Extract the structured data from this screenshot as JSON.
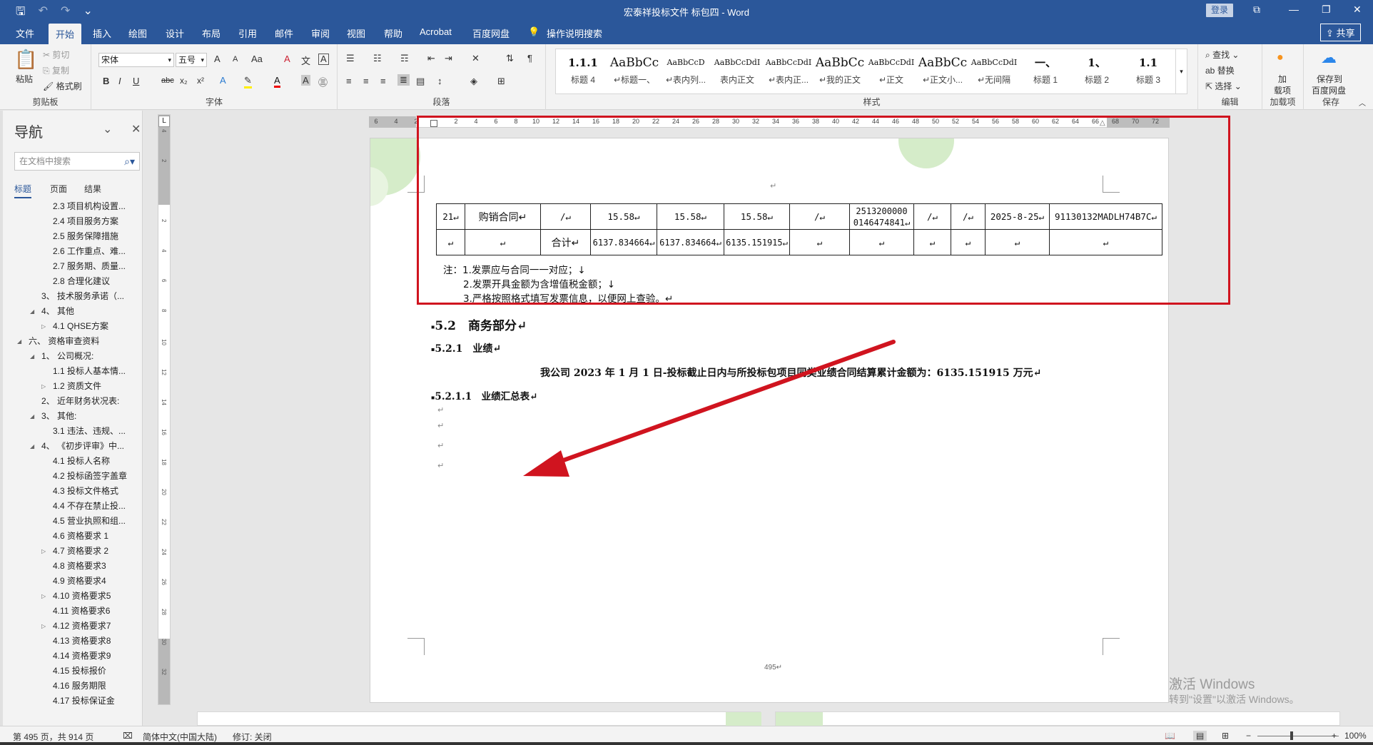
{
  "window": {
    "title": "宏泰祥投标文件 标包四 - Word",
    "login_label": "登录",
    "minimize_glyph": "—",
    "maximize_glyph": "❐",
    "close_glyph": "✕",
    "ribbon_display_glyph": "⧉",
    "save_glyph": "🖫",
    "undo_glyph": "↶",
    "redo_glyph": "↷",
    "customize_glyph": "⌄"
  },
  "ribbon_tabs": [
    "文件",
    "开始",
    "插入",
    "绘图",
    "设计",
    "布局",
    "引用",
    "邮件",
    "审阅",
    "视图",
    "帮助",
    "Acrobat",
    "百度网盘"
  ],
  "active_tab": "开始",
  "tell_me": "操作说明搜索",
  "share_label": "共享",
  "clipboard": {
    "paste": "粘贴",
    "cut": "剪切",
    "copy": "复制",
    "format_painter": "格式刷",
    "group": "剪贴板"
  },
  "font": {
    "name": "宋体",
    "size": "五号",
    "group": "字体",
    "bold": "B",
    "italic": "I",
    "underline": "U",
    "strikethrough": "abc",
    "subscript": "x₂",
    "superscript": "x²",
    "grow": "A",
    "shrink": "A",
    "case": "Aa",
    "clear": "A",
    "phonetic": "文",
    "border": "A"
  },
  "paragraph": {
    "group": "段落"
  },
  "styles": {
    "group": "样式",
    "items": [
      {
        "sample": "1.1.1",
        "name": "标题 4"
      },
      {
        "sample": "AaBbCc",
        "name": "↵标题一、"
      },
      {
        "sample": "AaBbCcD",
        "name": "↵表内列..."
      },
      {
        "sample": "AaBbCcDdI",
        "name": "表内正文"
      },
      {
        "sample": "AaBbCcDdI",
        "name": "↵表内正..."
      },
      {
        "sample": "AaBbCc",
        "name": "↵我的正文"
      },
      {
        "sample": "AaBbCcDdI",
        "name": "↵正文"
      },
      {
        "sample": "AaBbCc",
        "name": "↵正文小..."
      },
      {
        "sample": "AaBbCcDdI",
        "name": "↵无间隔"
      },
      {
        "sample": "一、",
        "name": "标题 1"
      },
      {
        "sample": "1、",
        "name": "标题 2"
      },
      {
        "sample": "1.1",
        "name": "标题 3"
      }
    ]
  },
  "editing": {
    "find": "查找",
    "replace": "替换",
    "select": "选择",
    "group": "编辑"
  },
  "addins": {
    "label1": "加",
    "label2": "载项",
    "group": "加载项"
  },
  "baidu": {
    "label1": "保存到",
    "label2": "百度网盘",
    "group": "保存"
  },
  "navigation": {
    "title": "导航",
    "search_placeholder": "在文档中搜索",
    "tabs": [
      "标题",
      "页面",
      "结果"
    ],
    "active_tab": "标题",
    "items": [
      {
        "text": "2.3 项目机构设置...",
        "level": 4,
        "arrow": ""
      },
      {
        "text": "2.4 项目服务方案",
        "level": 4,
        "arrow": ""
      },
      {
        "text": "2.5 服务保障措施",
        "level": 4,
        "arrow": ""
      },
      {
        "text": "2.6 工作重点、难...",
        "level": 4,
        "arrow": ""
      },
      {
        "text": "2.7 服务期、质量...",
        "level": 4,
        "arrow": ""
      },
      {
        "text": "2.8 合理化建议",
        "level": 4,
        "arrow": ""
      },
      {
        "text": "3、 技术服务承诺（...",
        "level": 3,
        "arrow": ""
      },
      {
        "text": "4、 其他",
        "level": 3,
        "arrow": "◢"
      },
      {
        "text": "4.1 QHSE方案",
        "level": 4,
        "arrow": "▷"
      },
      {
        "text": "六、 资格审查资料",
        "level": 2,
        "arrow": "◢"
      },
      {
        "text": "1、 公司概况:",
        "level": 3,
        "arrow": "◢"
      },
      {
        "text": "1.1 投标人基本情...",
        "level": 4,
        "arrow": ""
      },
      {
        "text": "1.2 资质文件",
        "level": 4,
        "arrow": "▷"
      },
      {
        "text": "2、 近年财务状况表:",
        "level": 3,
        "arrow": ""
      },
      {
        "text": "3、 其他:",
        "level": 3,
        "arrow": "◢"
      },
      {
        "text": "3.1 违法、违规、...",
        "level": 4,
        "arrow": ""
      },
      {
        "text": "4、 《初步评审》中...",
        "level": 3,
        "arrow": "◢"
      },
      {
        "text": "4.1 投标人名称",
        "level": 4,
        "arrow": ""
      },
      {
        "text": "4.2 投标函签字盖章",
        "level": 4,
        "arrow": ""
      },
      {
        "text": "4.3 投标文件格式",
        "level": 4,
        "arrow": ""
      },
      {
        "text": "4.4 不存在禁止投...",
        "level": 4,
        "arrow": ""
      },
      {
        "text": "4.5 营业执照和组...",
        "level": 4,
        "arrow": ""
      },
      {
        "text": "4.6 资格要求 1",
        "level": 4,
        "arrow": ""
      },
      {
        "text": "4.7 资格要求 2",
        "level": 4,
        "arrow": "▷"
      },
      {
        "text": "4.8 资格要求3",
        "level": 4,
        "arrow": ""
      },
      {
        "text": "4.9 资格要求4",
        "level": 4,
        "arrow": ""
      },
      {
        "text": "4.10 资格要求5",
        "level": 4,
        "arrow": "▷"
      },
      {
        "text": "4.11 资格要求6",
        "level": 4,
        "arrow": ""
      },
      {
        "text": "4.12 资格要求7",
        "level": 4,
        "arrow": "▷"
      },
      {
        "text": "4.13 资格要求8",
        "level": 4,
        "arrow": ""
      },
      {
        "text": "4.14 资格要求9",
        "level": 4,
        "arrow": ""
      },
      {
        "text": "4.15 投标报价",
        "level": 4,
        "arrow": ""
      },
      {
        "text": "4.16 服务期限",
        "level": 4,
        "arrow": ""
      },
      {
        "text": "4.17 投标保证金",
        "level": 4,
        "arrow": ""
      }
    ]
  },
  "ruler": {
    "h_labels": [
      "6",
      "4",
      "2",
      "",
      "2",
      "4",
      "6",
      "8",
      "10",
      "12",
      "14",
      "16",
      "18",
      "20",
      "22",
      "24",
      "26",
      "28",
      "30",
      "32",
      "34",
      "36",
      "38",
      "40",
      "42",
      "44",
      "46",
      "48",
      "50",
      "52",
      "54",
      "56",
      "58",
      "60",
      "62",
      "64",
      "66",
      "68",
      "70",
      "72"
    ],
    "v_labels": [
      "4",
      "2",
      "",
      "2",
      "4",
      "6",
      "8",
      "10",
      "12",
      "14",
      "16",
      "18",
      "20",
      "22",
      "24",
      "26",
      "28",
      "30",
      "32"
    ]
  },
  "document": {
    "table_rows": [
      [
        "21↵",
        "购销合同↵",
        "/↵",
        "15.58↵",
        "15.58↵",
        "15.58↵",
        "/↵",
        "2513200000 0146474841↵",
        "/↵",
        "/↵",
        "2025-8-25↵",
        "91130132MADLH74B7C↵"
      ],
      [
        "↵",
        "↵",
        "合计↵",
        "6137.834664↵",
        "6137.834664↵",
        "6135.151915↵",
        "↵",
        "↵",
        "↵",
        "↵",
        "↵",
        "↵"
      ]
    ],
    "notes": [
      "注：1.发票应与合同一一对应；↓",
      "2.发票开具金额为含增值税金额；↓",
      "3.严格按照格式填写发票信息，以便网上查验。↵"
    ],
    "heading_52": "5.2　商务部分↵",
    "heading_521": "5.2.1　业绩↵",
    "body_line": "我公司 2023 年 1 月 1 日-投标截止日内与所投标包项目同类业绩合同结算累计金额为：6135.151915 万元↵",
    "heading_5211": "5.2.1.1　业绩汇总表↵",
    "para_marks": [
      "↵",
      "↵",
      "↵",
      "↵"
    ],
    "top_mark": "↵",
    "page_number": "495↵"
  },
  "watermark": {
    "line1": "激活 Windows",
    "line2": "转到\"设置\"以激活 Windows。"
  },
  "status": {
    "page": "第 495 页，共 914 页",
    "language": "简体中文(中国大陆)",
    "track_changes": "修订: 关闭",
    "zoom": "100%",
    "zoom_minus": "−",
    "zoom_plus": "+"
  },
  "colors": {
    "brand": "#2b579a",
    "annotation": "#d0141f"
  }
}
